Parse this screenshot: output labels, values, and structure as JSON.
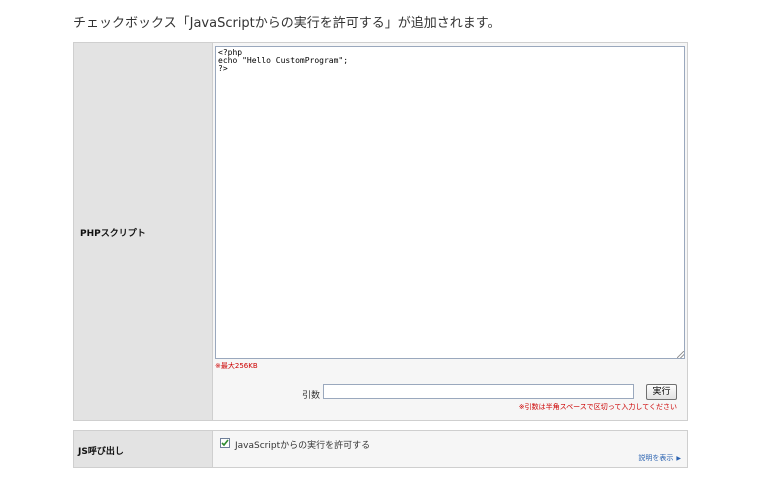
{
  "caption": "チェックボックス「JavaScriptからの実行を許可する」が追加されます。",
  "php_script": {
    "label": "PHPスクリプト",
    "code": "<?php\necho \"Hello CustomProgram\";\n?>",
    "max_size_note": "※最大256KB",
    "arg_label": "引数",
    "arg_value": "",
    "exec_button": "実行",
    "arg_note": "※引数は半角スペースで区切って入力してください"
  },
  "js_call": {
    "label": "JS呼び出し",
    "checkbox_checked": true,
    "checkbox_label": "JavaScriptからの実行を許可する",
    "help_link": "説明を表示"
  },
  "colors": {
    "label_bg": "#e3e3e3",
    "content_bg": "#f6f6f6",
    "note_red": "#cc0000",
    "link_blue": "#2a62b0",
    "check_green": "#2e8b2e"
  }
}
